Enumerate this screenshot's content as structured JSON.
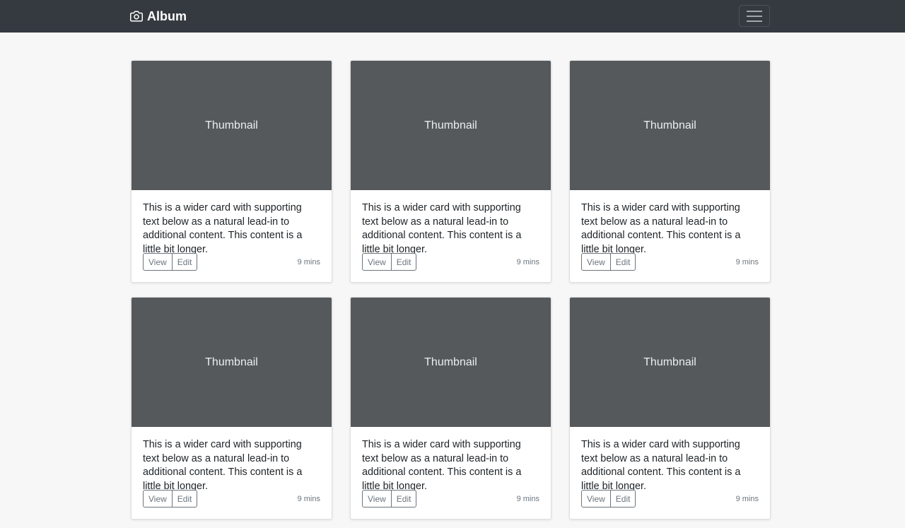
{
  "navbar": {
    "brand_label": "Album",
    "brand_icon": "camera-icon",
    "toggler_icon": "hamburger-menu-icon"
  },
  "colors": {
    "navbar_bg": "#343a40",
    "thumbnail_bg": "#55595c",
    "page_bg": "#f7f7f7",
    "button_outline": "#6c757d"
  },
  "cards": [
    {
      "thumbnail": "Thumbnail",
      "text": "This is a wider card with supporting text below as a natural lead-in to additional content. This content is a little bit longer.",
      "view_label": "View",
      "edit_label": "Edit",
      "time": "9 mins"
    },
    {
      "thumbnail": "Thumbnail",
      "text": "This is a wider card with supporting text below as a natural lead-in to additional content. This content is a little bit longer.",
      "view_label": "View",
      "edit_label": "Edit",
      "time": "9 mins"
    },
    {
      "thumbnail": "Thumbnail",
      "text": "This is a wider card with supporting text below as a natural lead-in to additional content. This content is a little bit longer.",
      "view_label": "View",
      "edit_label": "Edit",
      "time": "9 mins"
    },
    {
      "thumbnail": "Thumbnail",
      "text": "This is a wider card with supporting text below as a natural lead-in to additional content. This content is a little bit longer.",
      "view_label": "View",
      "edit_label": "Edit",
      "time": "9 mins"
    },
    {
      "thumbnail": "Thumbnail",
      "text": "This is a wider card with supporting text below as a natural lead-in to additional content. This content is a little bit longer.",
      "view_label": "View",
      "edit_label": "Edit",
      "time": "9 mins"
    },
    {
      "thumbnail": "Thumbnail",
      "text": "This is a wider card with supporting text below as a natural lead-in to additional content. This content is a little bit longer.",
      "view_label": "View",
      "edit_label": "Edit",
      "time": "9 mins"
    }
  ]
}
